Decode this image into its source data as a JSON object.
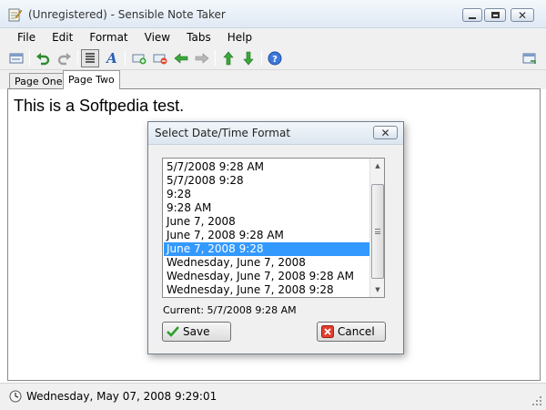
{
  "window": {
    "title": "(Unregistered) - Sensible Note Taker"
  },
  "menu": [
    "File",
    "Edit",
    "Format",
    "View",
    "Tabs",
    "Help"
  ],
  "toolbar": {
    "icons": [
      "notes-icon",
      "undo-icon",
      "redo-icon",
      "justify-icon",
      "font-icon",
      "add-tab-icon",
      "remove-tab-icon",
      "move-left-icon",
      "move-right-icon",
      "move-up-icon",
      "move-down-icon",
      "help-icon",
      "new-window-icon"
    ]
  },
  "tabs": [
    {
      "label": "Page One",
      "active": false
    },
    {
      "label": "Page Two",
      "active": true
    }
  ],
  "editor": {
    "text": "This is a Softpedia test."
  },
  "dialog": {
    "title": "Select Date/Time Format",
    "formats": [
      "5/7/2008 9:28 AM",
      "5/7/2008 9:28",
      "9:28",
      "9:28 AM",
      "June 7, 2008",
      "June 7, 2008 9:28 AM",
      "June 7, 2008 9:28",
      "Wednesday, June 7, 2008",
      "Wednesday, June 7, 2008 9:28 AM",
      "Wednesday, June 7, 2008 9:28"
    ],
    "selected_index": 6,
    "current_label": "Current: 5/7/2008 9:28 AM",
    "save_label": "Save",
    "cancel_label": "Cancel"
  },
  "status": {
    "datetime": "Wednesday, May 07, 2008 9:29:01"
  },
  "colors": {
    "selection": "#3399ff",
    "chrome": "#f0f0f0",
    "arrow_green": "#2e9e2e"
  }
}
